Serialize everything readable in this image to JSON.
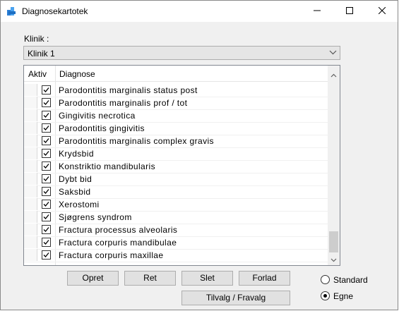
{
  "window": {
    "title": "Diagnosekartotek"
  },
  "klinik": {
    "label": "Klinik :",
    "selected": "Klinik 1"
  },
  "grid": {
    "headers": {
      "aktiv": "Aktiv",
      "diagnose": "Diagnose"
    },
    "rows": [
      {
        "aktiv": true,
        "diagnose": "Parodontitis marginalis status post"
      },
      {
        "aktiv": true,
        "diagnose": "Parodontitis marginalis prof / tot"
      },
      {
        "aktiv": true,
        "diagnose": "Gingivitis necrotica"
      },
      {
        "aktiv": true,
        "diagnose": "Parodontitis gingivitis"
      },
      {
        "aktiv": true,
        "diagnose": "Parodontitis marginalis complex gravis"
      },
      {
        "aktiv": true,
        "diagnose": "Krydsbid"
      },
      {
        "aktiv": true,
        "diagnose": "Konstriktio mandibularis"
      },
      {
        "aktiv": true,
        "diagnose": "Dybt bid"
      },
      {
        "aktiv": true,
        "diagnose": "Saksbid"
      },
      {
        "aktiv": true,
        "diagnose": "Xerostomi"
      },
      {
        "aktiv": true,
        "diagnose": "Sjøgrens syndrom"
      },
      {
        "aktiv": true,
        "diagnose": "Fractura processus alveolaris"
      },
      {
        "aktiv": true,
        "diagnose": "Fractura corpuris mandibulae"
      },
      {
        "aktiv": true,
        "diagnose": "Fractura corpuris maxillae"
      }
    ]
  },
  "buttons": {
    "opret": "Opret",
    "ret": "Ret",
    "slet": "Slet",
    "forlad": "Forlad",
    "tilvalg": "Tilvalg / Fravalg"
  },
  "radios": {
    "standard": "Standard",
    "egne": "Egne",
    "selected": "egne"
  },
  "colors": {
    "accent": "#1e88e5",
    "check": "#000000"
  }
}
